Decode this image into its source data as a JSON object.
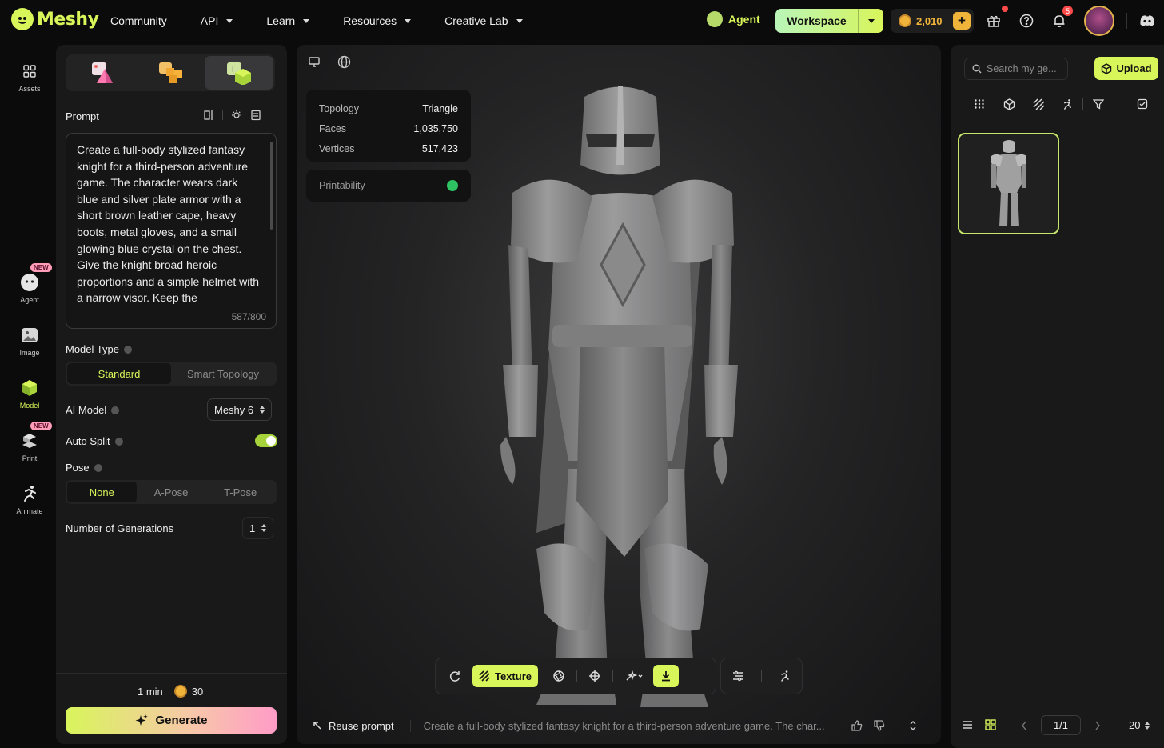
{
  "brand": {
    "name": "Meshy"
  },
  "nav": [
    {
      "label": "Community",
      "dropdown": false
    },
    {
      "label": "API",
      "dropdown": true
    },
    {
      "label": "Learn",
      "dropdown": true
    },
    {
      "label": "Resources",
      "dropdown": true
    },
    {
      "label": "Creative Lab",
      "dropdown": true
    }
  ],
  "header": {
    "agent_label": "Agent",
    "workspace_label": "Workspace",
    "credits": "2,010",
    "notification_count": "5"
  },
  "rail": [
    {
      "label": "Assets",
      "icon": "assets-grid-icon",
      "badge": ""
    },
    {
      "label": "Agent",
      "icon": "agent-icon",
      "badge": "NEW"
    },
    {
      "label": "Image",
      "icon": "image-icon",
      "badge": ""
    },
    {
      "label": "Model",
      "icon": "model-cube-icon",
      "badge": ""
    },
    {
      "label": "Print",
      "icon": "print-icon",
      "badge": "NEW"
    },
    {
      "label": "Animate",
      "icon": "animate-runner-icon",
      "badge": ""
    }
  ],
  "panel": {
    "prompt_label": "Prompt",
    "prompt_text": "Create a full-body stylized fantasy knight for a third-person adventure game. The character wears dark blue and silver plate armor with a short brown leather cape, heavy boots, metal gloves, and a small glowing blue crystal on the chest. Give the knight broad heroic proportions and a simple helmet with a narrow visor. Keep the",
    "char_count": "587/800",
    "model_type_label": "Model Type",
    "model_types": [
      "Standard",
      "Smart Topology"
    ],
    "model_type_selected": "Standard",
    "ai_model_label": "AI Model",
    "ai_model_value": "Meshy 6",
    "auto_split_label": "Auto Split",
    "auto_split_on": true,
    "pose_label": "Pose",
    "poses": [
      "None",
      "A-Pose",
      "T-Pose"
    ],
    "pose_selected": "None",
    "generations_label": "Number of Generations",
    "generations_value": "1",
    "time_estimate": "1 min",
    "cost": "30",
    "generate_label": "Generate"
  },
  "viewer": {
    "stats": [
      {
        "key": "Topology",
        "value": "Triangle"
      },
      {
        "key": "Faces",
        "value": "1,035,750"
      },
      {
        "key": "Vertices",
        "value": "517,423"
      }
    ],
    "printability_label": "Printability",
    "texture_label": "Texture",
    "reuse_label": "Reuse prompt",
    "footer_prompt": "Create a full-body stylized fantasy knight for a third-person adventure game. The char..."
  },
  "assets": {
    "search_placeholder": "Search my ge...",
    "upload_label": "Upload",
    "page": "1/1",
    "page_size": "20"
  },
  "colors": {
    "accent": "#d8f55a",
    "panel_bg": "#19191a",
    "credit_gold": "#f0b43a",
    "badge_pink": "#ff9cb7"
  }
}
